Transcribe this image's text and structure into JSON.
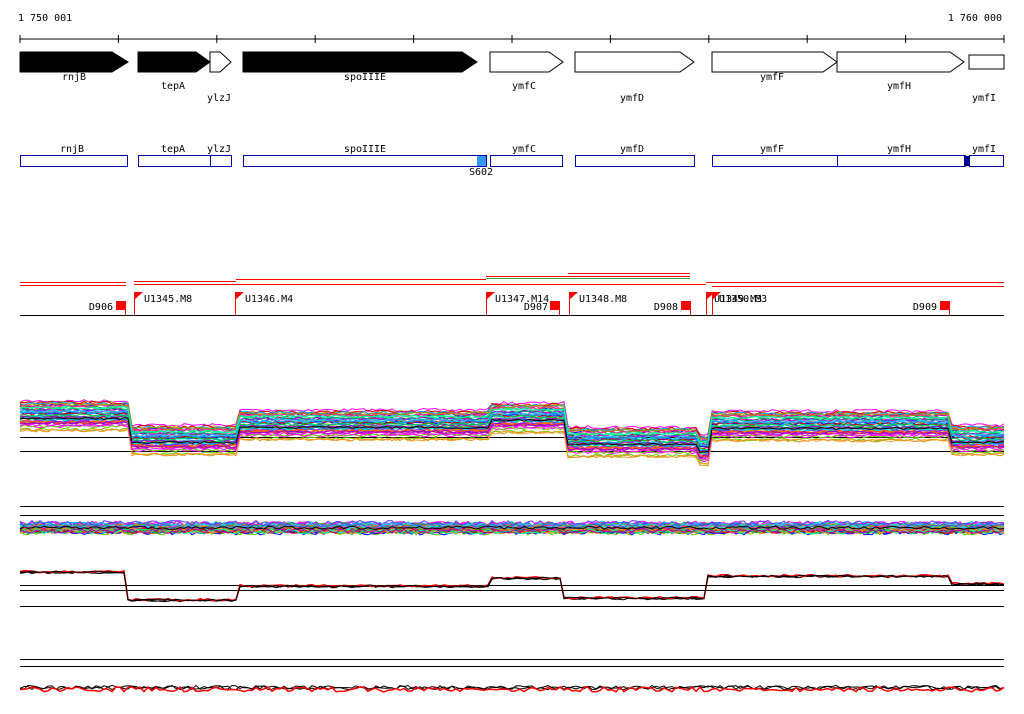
{
  "ruler": {
    "start_label": "1 750 001",
    "end_label": "1 760 000"
  },
  "genes": [
    {
      "name": "rnjB",
      "strand": "forward",
      "style": "filled"
    },
    {
      "name": "tepA",
      "strand": "forward",
      "style": "filled"
    },
    {
      "name": "ylzJ",
      "strand": "forward",
      "style": "outline"
    },
    {
      "name": "spoIIIE",
      "strand": "forward",
      "style": "filled"
    },
    {
      "name": "ymfC",
      "strand": "forward",
      "style": "outline"
    },
    {
      "name": "ymfD",
      "strand": "forward",
      "style": "outline"
    },
    {
      "name": "ymfF",
      "strand": "forward",
      "style": "outline"
    },
    {
      "name": "ymfH",
      "strand": "forward",
      "style": "outline"
    },
    {
      "name": "ymfI",
      "strand": "forward",
      "style": "outline"
    }
  ],
  "feature_labels": [
    "S602"
  ],
  "segment_markers": [
    {
      "label": "D906"
    },
    {
      "label": "U1345.M8"
    },
    {
      "label": "U1346.M4"
    },
    {
      "label": "U1347.M14"
    },
    {
      "label": "D907"
    },
    {
      "label": "U1348.M8"
    },
    {
      "label": "D908"
    },
    {
      "label": "U1349.M3"
    },
    {
      "label": "U1350.M3"
    },
    {
      "label": "D909"
    }
  ],
  "colors": {
    "gene_fill": "#000000",
    "protein_box": "#0000aa",
    "feature_mark": "#3399ff",
    "feature_mark_dark": "#000099",
    "marker": "#ff0000",
    "segment_green": "#33aa33"
  }
}
